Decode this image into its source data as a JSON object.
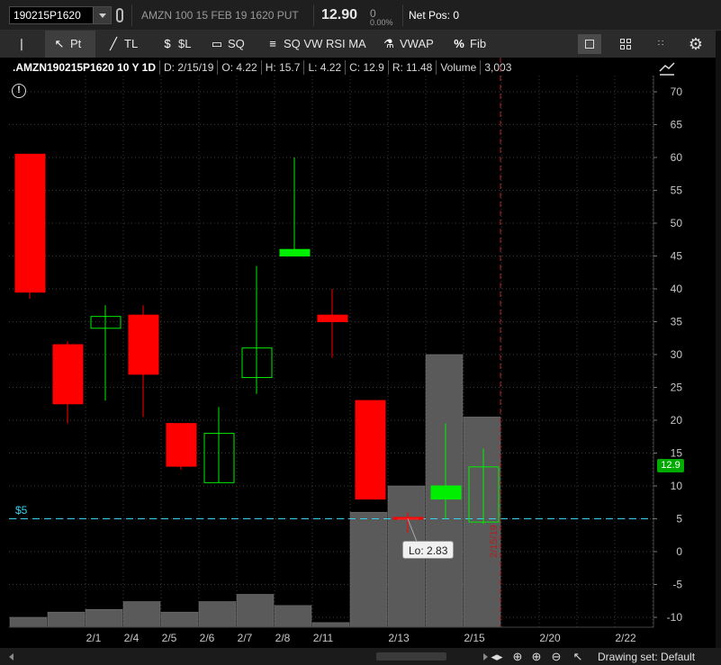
{
  "topbar": {
    "symbol": "190215P1620",
    "description": "AMZN 100 15 FEB 19 1620 PUT",
    "price": "12.90",
    "change": "0",
    "change_pct": "0.00%",
    "net_pos": "Net Pos: 0"
  },
  "toolbar": {
    "tools": [
      {
        "label": "",
        "icon": "pin-icon"
      },
      {
        "label": "Pt",
        "icon": "pointer-icon"
      },
      {
        "label": "TL",
        "icon": "trendline-icon"
      },
      {
        "label": "$L",
        "icon": "price-level-icon"
      },
      {
        "label": "SQ",
        "icon": "rectangle-icon"
      },
      {
        "label": "SQ VW RSI MA",
        "icon": "studies-icon"
      },
      {
        "label": "VWAP",
        "icon": "flask-icon"
      },
      {
        "label": "Fib",
        "icon": "percent-icon"
      }
    ],
    "right_icons": [
      "single-layout-icon",
      "grid-layout-icon",
      "grid-small-icon",
      "gear-icon"
    ]
  },
  "header": {
    "symbol_line": ".AMZN190215P1620 10 Y 1D",
    "date": "D: 2/15/19",
    "open": "O: 4.22",
    "high": "H: 15.7",
    "low": "L: 4.22",
    "close": "C: 12.9",
    "range": "R: 11.48",
    "volume_label": "Volume",
    "volume": "3,003"
  },
  "chart_data": {
    "type": "candlestick",
    "y_axis_ticks": [
      70,
      65,
      60,
      55,
      50,
      45,
      40,
      35,
      30,
      25,
      20,
      15,
      10,
      5,
      0,
      -5,
      -10
    ],
    "ylim": [
      -10,
      70
    ],
    "x_labels": [
      "2/1",
      "2/4",
      "2/5",
      "2/6",
      "2/7",
      "2/8",
      "2/11",
      "2/13",
      "2/15",
      "2/20",
      "2/22"
    ],
    "candles": [
      {
        "open": 60.5,
        "close": 39.5,
        "high": 60.5,
        "low": 38.5,
        "dir": "down"
      },
      {
        "open": 31.5,
        "close": 22.5,
        "high": 32.0,
        "low": 19.5,
        "dir": "down"
      },
      {
        "open": 34.0,
        "close": 35.8,
        "high": 37.5,
        "low": 23.0,
        "dir": "up"
      },
      {
        "open": 36.0,
        "close": 27.0,
        "high": 37.5,
        "low": 20.5,
        "dir": "down"
      },
      {
        "open": 19.5,
        "close": 13.0,
        "high": 19.5,
        "low": 12.5,
        "dir": "down"
      },
      {
        "open": 10.5,
        "close": 18.0,
        "high": 22.0,
        "low": 10.5,
        "dir": "up"
      },
      {
        "open": 26.5,
        "close": 31.0,
        "high": 43.5,
        "low": 24.0,
        "dir": "up"
      },
      {
        "open": 45.0,
        "close": 46.0,
        "high": 60.0,
        "low": 45.0,
        "dir": "up"
      },
      {
        "open": 36.0,
        "close": 35.0,
        "high": 40.0,
        "low": 29.5,
        "dir": "down"
      },
      {
        "open": 23.0,
        "close": 8.0,
        "high": 23.0,
        "low": 8.0,
        "dir": "down"
      },
      {
        "open": 5.2,
        "close": 5.0,
        "high": 6.0,
        "low": 2.83,
        "dir": "down"
      },
      {
        "open": 8.0,
        "close": 10.0,
        "high": 19.5,
        "low": 5.0,
        "dir": "up"
      },
      {
        "open": 4.5,
        "close": 12.9,
        "high": 15.7,
        "low": 4.22,
        "dir": "up"
      }
    ],
    "volume_bars_top": [
      -10.0,
      -9.2,
      -8.8,
      -7.6,
      -9.2,
      -7.6,
      -6.5,
      -8.2,
      -10.8,
      6.0,
      10.0,
      30.0,
      20.5
    ],
    "series": [
      {
        "name": "Volume"
      }
    ],
    "price_level": 5,
    "price_level_label": "$5",
    "last_price_label": "12.9",
    "low_tooltip": "Lo: 2.83",
    "expiration_label": "2/15/19",
    "colors": {
      "up": "#00ee00",
      "down": "#ff0000",
      "volume": "#5a5a5a",
      "level": "#3ad0ee",
      "expiry": "#b02020"
    }
  },
  "bottombar": {
    "drawing_set": "Drawing set: Default"
  }
}
